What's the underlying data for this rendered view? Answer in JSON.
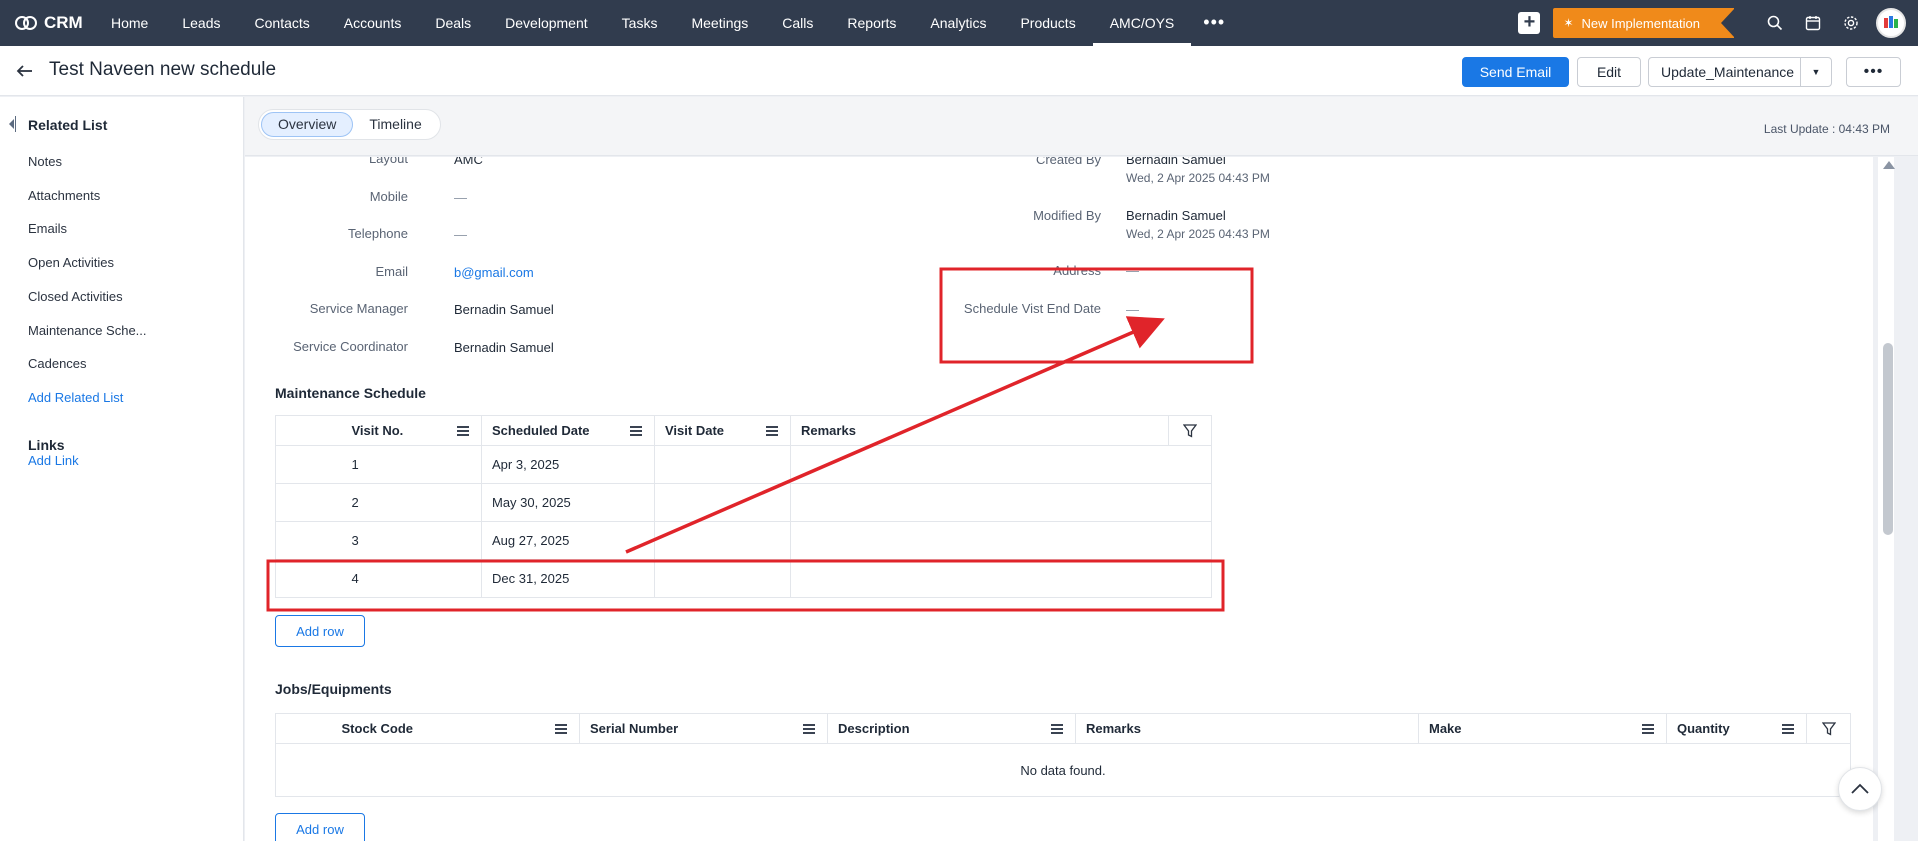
{
  "brand": {
    "name": "CRM"
  },
  "nav": {
    "items": [
      {
        "label": "Home"
      },
      {
        "label": "Leads"
      },
      {
        "label": "Contacts"
      },
      {
        "label": "Accounts"
      },
      {
        "label": "Deals"
      },
      {
        "label": "Development"
      },
      {
        "label": "Tasks"
      },
      {
        "label": "Meetings"
      },
      {
        "label": "Calls"
      },
      {
        "label": "Reports"
      },
      {
        "label": "Analytics"
      },
      {
        "label": "Products"
      },
      {
        "label": "AMC/OYS"
      }
    ],
    "active": "AMC/OYS",
    "more": "•••",
    "promo_label": "New Implementation"
  },
  "header": {
    "title": "Test Naveen new schedule",
    "send_email": "Send Email",
    "edit": "Edit",
    "update_maintenance": "Update_Maintenance",
    "more": "•••"
  },
  "sidebar": {
    "heading": "Related List",
    "items": [
      {
        "label": "Notes"
      },
      {
        "label": "Attachments"
      },
      {
        "label": "Emails"
      },
      {
        "label": "Open Activities"
      },
      {
        "label": "Closed Activities"
      },
      {
        "label": "Maintenance Sche..."
      },
      {
        "label": "Cadences"
      }
    ],
    "add_related": "Add Related List",
    "links_heading": "Links",
    "add_link": "Add Link"
  },
  "tabs": {
    "overview": "Overview",
    "timeline": "Timeline"
  },
  "last_update": "Last Update : 04:43 PM",
  "fields_left": [
    {
      "label": "Layout",
      "value": "AMC"
    },
    {
      "label": "Mobile",
      "value": "—"
    },
    {
      "label": "Telephone",
      "value": "—"
    },
    {
      "label": "Email",
      "value": "b@gmail.com"
    },
    {
      "label": "Service Manager",
      "value": "Bernadin Samuel"
    },
    {
      "label": "Service Coordinator",
      "value": "Bernadin Samuel"
    }
  ],
  "fields_right": {
    "created_by": {
      "label": "Created By",
      "value": "Bernadin Samuel",
      "sub": "Wed, 2 Apr 2025 04:43 PM"
    },
    "modified_by": {
      "label": "Modified By",
      "value": "Bernadin Samuel",
      "sub": "Wed, 2 Apr 2025 04:43 PM"
    },
    "address": {
      "label": "Address",
      "value": "—"
    },
    "schedule_end": {
      "label": "Schedule Vist End Date",
      "value": "—"
    }
  },
  "maintenance": {
    "title": "Maintenance Schedule",
    "columns": [
      "Visit No.",
      "Scheduled Date",
      "Visit Date",
      "Remarks"
    ],
    "rows": [
      {
        "visit_no": "1",
        "scheduled": "Apr 3, 2025",
        "visit_date": "",
        "remarks": ""
      },
      {
        "visit_no": "2",
        "scheduled": "May 30, 2025",
        "visit_date": "",
        "remarks": ""
      },
      {
        "visit_no": "3",
        "scheduled": "Aug 27, 2025",
        "visit_date": "",
        "remarks": ""
      },
      {
        "visit_no": "4",
        "scheduled": "Dec 31, 2025",
        "visit_date": "",
        "remarks": ""
      }
    ],
    "add_row": "Add row"
  },
  "jobs": {
    "title": "Jobs/Equipments",
    "columns": [
      "Stock Code",
      "Serial Number",
      "Description",
      "Remarks",
      "Make",
      "Quantity"
    ],
    "empty": "No data found.",
    "add_row": "Add row"
  },
  "colors": {
    "nav_bg": "#313c4e",
    "accent": "#1a78e5",
    "promo": "#f08a1a",
    "annotation": "#e0242a"
  }
}
